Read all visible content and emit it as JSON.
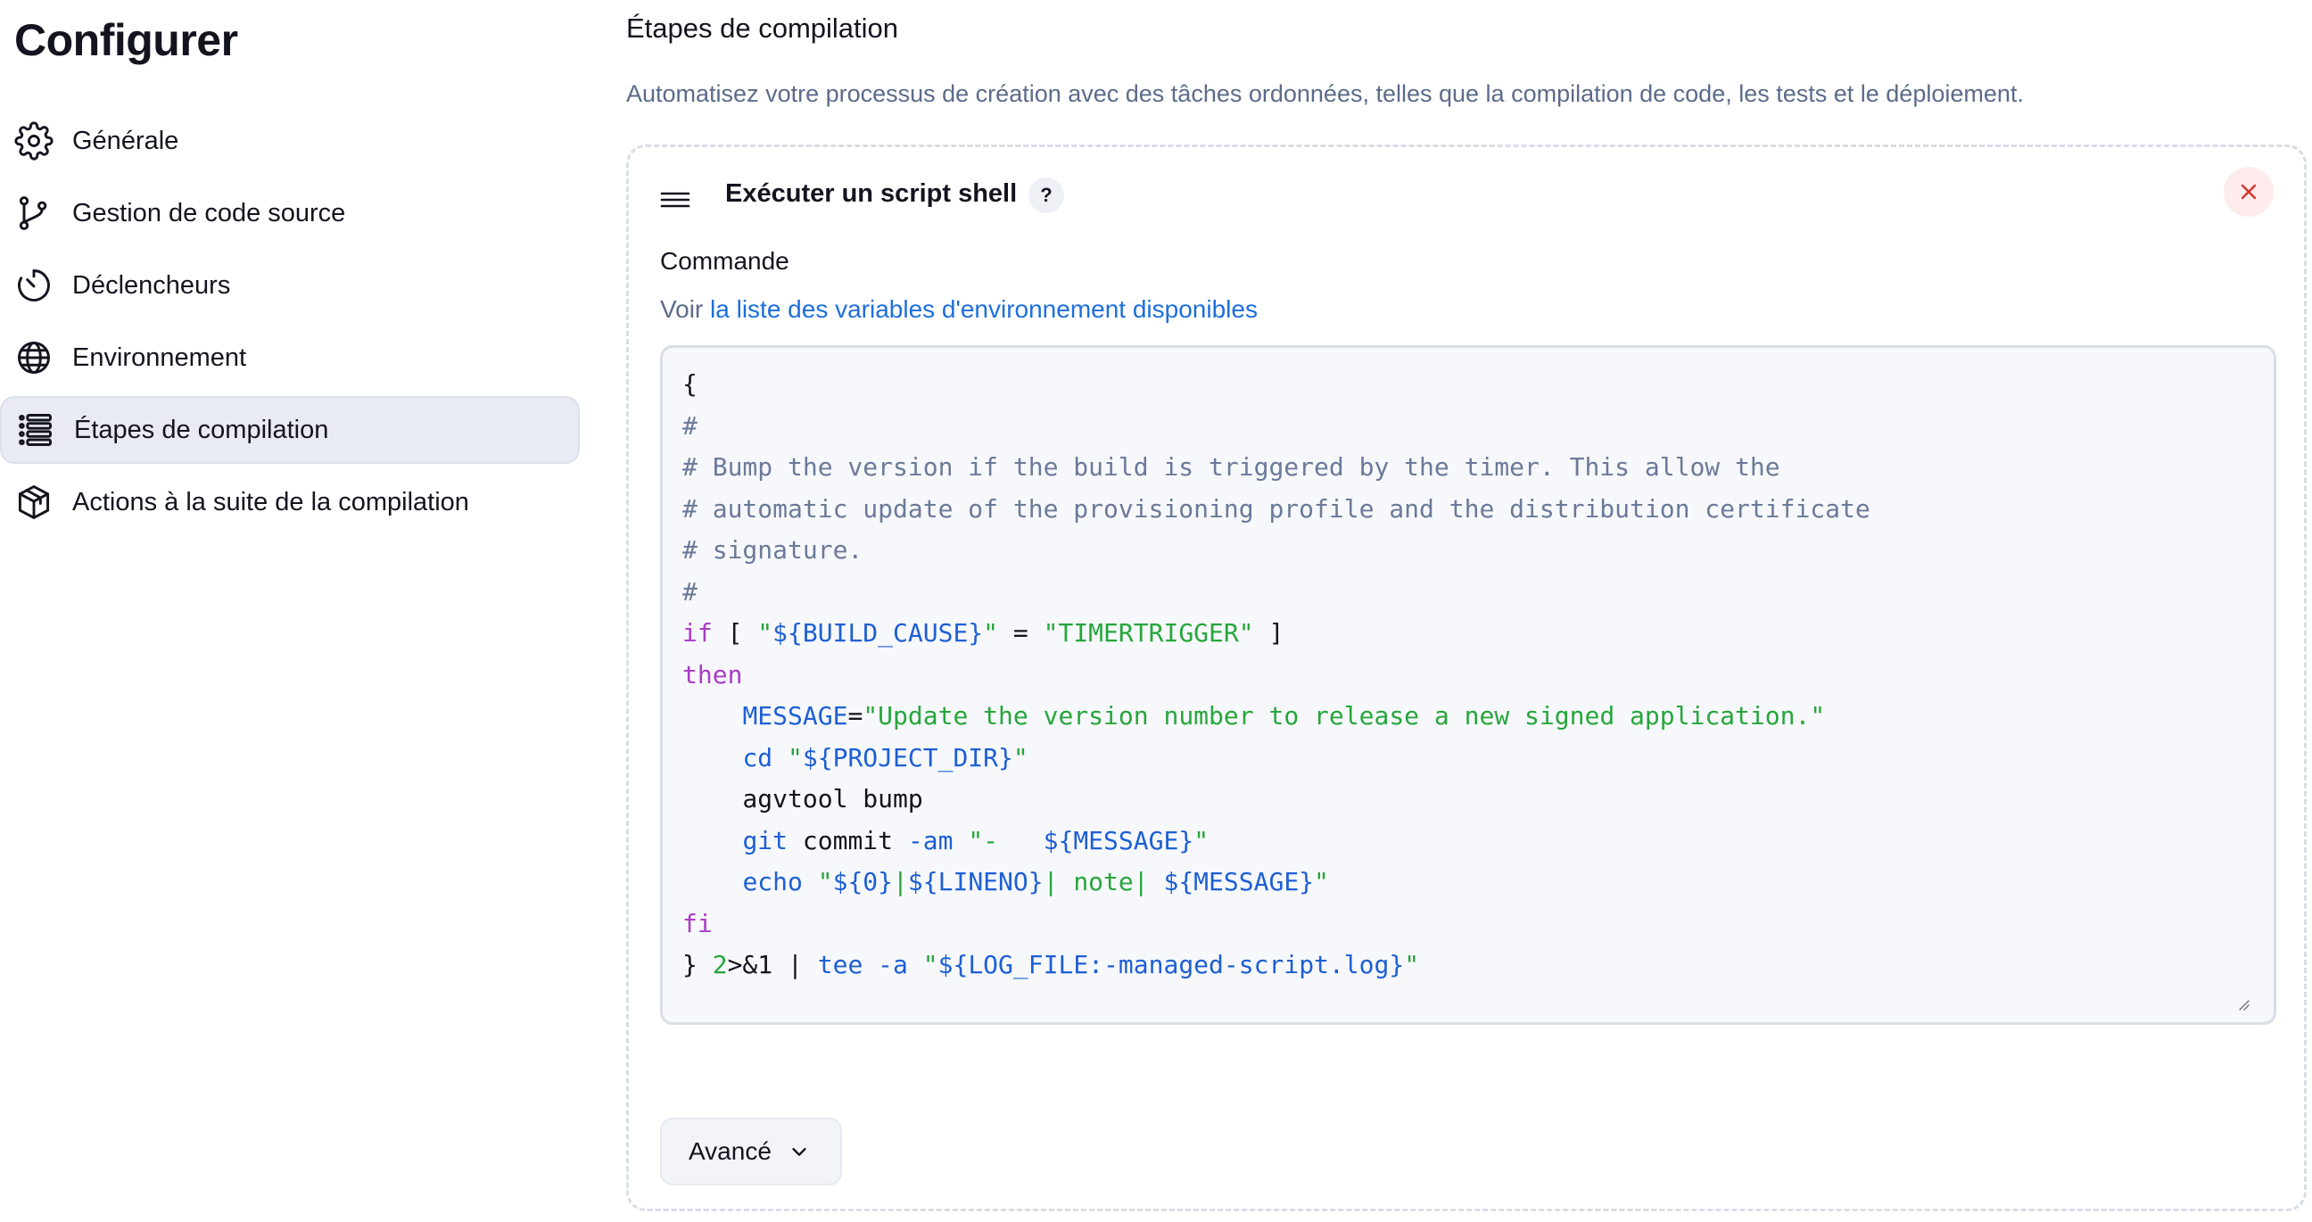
{
  "sidebar": {
    "title": "Configurer",
    "items": [
      {
        "label": "Générale",
        "icon": "gear-icon",
        "active": false
      },
      {
        "label": "Gestion de code source",
        "icon": "git-branch-icon",
        "active": false
      },
      {
        "label": "Déclencheurs",
        "icon": "timer-icon",
        "active": false
      },
      {
        "label": "Environnement",
        "icon": "globe-icon",
        "active": false
      },
      {
        "label": "Étapes de compilation",
        "icon": "list-icon",
        "active": true
      },
      {
        "label": "Actions à la suite de la compilation",
        "icon": "package-icon",
        "active": false
      }
    ]
  },
  "main": {
    "section_title": "Étapes de compilation",
    "section_description": "Automatisez votre processus de création avec des tâches ordonnées, telles que la compilation de code, les tests et le déploiement.",
    "step": {
      "drag_icon": "drag-handle-icon",
      "title": "Exécuter un script shell",
      "help_label": "?",
      "close_icon": "close-icon",
      "command_label": "Commande",
      "env_help_prefix": "Voir ",
      "env_help_link": "la liste des variables d'environnement disponibles",
      "code_lines": [
        [
          {
            "t": "{",
            "c": "text"
          }
        ],
        [
          {
            "t": "#",
            "c": "comment"
          }
        ],
        [
          {
            "t": "# Bump the version if the build is triggered by the timer. This allow the",
            "c": "comment"
          }
        ],
        [
          {
            "t": "# automatic update of the provisioning profile and the distribution certificate",
            "c": "comment"
          }
        ],
        [
          {
            "t": "# signature.",
            "c": "comment"
          }
        ],
        [
          {
            "t": "#",
            "c": "comment"
          }
        ],
        [
          {
            "t": "if",
            "c": "keyword"
          },
          {
            "t": " [ ",
            "c": "text"
          },
          {
            "t": "\"",
            "c": "string"
          },
          {
            "t": "${BUILD_CAUSE}",
            "c": "var"
          },
          {
            "t": "\"",
            "c": "string"
          },
          {
            "t": " = ",
            "c": "text"
          },
          {
            "t": "\"TIMERTRIGGER\"",
            "c": "string"
          },
          {
            "t": " ]",
            "c": "text"
          }
        ],
        [
          {
            "t": "then",
            "c": "keyword"
          }
        ],
        [
          {
            "t": "    ",
            "c": "text"
          },
          {
            "t": "MESSAGE",
            "c": "var"
          },
          {
            "t": "=",
            "c": "text"
          },
          {
            "t": "\"Update the version number to release a new signed application.\"",
            "c": "string"
          }
        ],
        [
          {
            "t": "    ",
            "c": "text"
          },
          {
            "t": "cd",
            "c": "cmd"
          },
          {
            "t": " ",
            "c": "text"
          },
          {
            "t": "\"",
            "c": "string"
          },
          {
            "t": "${PROJECT_DIR}",
            "c": "var"
          },
          {
            "t": "\"",
            "c": "string"
          }
        ],
        [
          {
            "t": "    agvtool bump",
            "c": "text"
          }
        ],
        [
          {
            "t": "    ",
            "c": "text"
          },
          {
            "t": "git",
            "c": "cmd"
          },
          {
            "t": " commit ",
            "c": "text"
          },
          {
            "t": "-am",
            "c": "cmd"
          },
          {
            "t": " ",
            "c": "text"
          },
          {
            "t": "\"-   ",
            "c": "string"
          },
          {
            "t": "${MESSAGE}",
            "c": "var"
          },
          {
            "t": "\"",
            "c": "string"
          }
        ],
        [
          {
            "t": "    ",
            "c": "text"
          },
          {
            "t": "echo",
            "c": "cmd"
          },
          {
            "t": " ",
            "c": "text"
          },
          {
            "t": "\"",
            "c": "string"
          },
          {
            "t": "${0}",
            "c": "var"
          },
          {
            "t": "|",
            "c": "string"
          },
          {
            "t": "${LINENO}",
            "c": "var"
          },
          {
            "t": "| note| ",
            "c": "string"
          },
          {
            "t": "${MESSAGE}",
            "c": "var"
          },
          {
            "t": "\"",
            "c": "string"
          }
        ],
        [
          {
            "t": "fi",
            "c": "keyword"
          }
        ],
        [
          {
            "t": "} ",
            "c": "text"
          },
          {
            "t": "2",
            "c": "num"
          },
          {
            "t": ">&1 | ",
            "c": "text"
          },
          {
            "t": "tee",
            "c": "cmd"
          },
          {
            "t": " ",
            "c": "text"
          },
          {
            "t": "-a",
            "c": "cmd"
          },
          {
            "t": " ",
            "c": "text"
          },
          {
            "t": "\"",
            "c": "string"
          },
          {
            "t": "${LOG_FILE:-managed-script.log}",
            "c": "var"
          },
          {
            "t": "\"",
            "c": "string"
          }
        ]
      ],
      "advanced_label": "Avancé",
      "advanced_icon": "chevron-down-icon"
    }
  },
  "colors": {
    "accent_link": "#1d6fdc",
    "active_nav_bg": "#e8ebf3",
    "description_text": "#5b6b8a",
    "close_bg": "#fdeceb",
    "close_icon": "#d9342b"
  }
}
